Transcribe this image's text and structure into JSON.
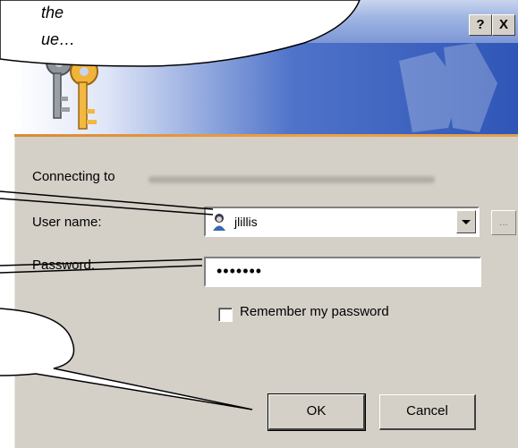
{
  "callout": {
    "line1": "the",
    "line2": "ue…"
  },
  "titlebar": {
    "help": "?",
    "close": "X"
  },
  "dialog": {
    "connecting_label": "Connecting to",
    "username_label": "User name:",
    "username_value": "jlillis",
    "password_label": "Password:",
    "password_value": "•••••••",
    "browse_label": "...",
    "remember_label": "Remember my password",
    "ok_label": "OK",
    "cancel_label": "Cancel"
  }
}
